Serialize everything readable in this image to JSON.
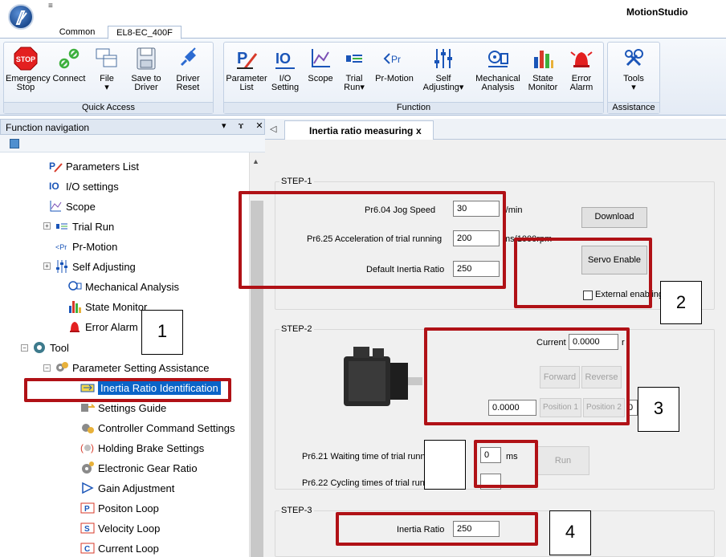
{
  "app": {
    "title": "MotionStudio",
    "qa_arrow": "≡"
  },
  "ribbon_tabs": [
    "Common",
    "EL8-EC_400F"
  ],
  "ribbon": {
    "quick_access": {
      "label": "Quick Access",
      "buttons": [
        {
          "label1": "Emergency",
          "label2": "Stop"
        },
        {
          "label1": "Connect",
          "label2": ""
        },
        {
          "label1": "File",
          "label2": "▾"
        },
        {
          "label1": "Save to",
          "label2": "Driver"
        },
        {
          "label1": "Driver",
          "label2": "Reset"
        }
      ]
    },
    "function": {
      "label": "Function",
      "buttons": [
        {
          "label1": "Parameter",
          "label2": "List"
        },
        {
          "label1": "I/O",
          "label2": "Setting"
        },
        {
          "label1": "Scope",
          "label2": ""
        },
        {
          "label1": "Trial",
          "label2": "Run▾"
        },
        {
          "label1": "Pr-Motion",
          "label2": ""
        },
        {
          "label1": "Self",
          "label2": "Adjusting▾"
        },
        {
          "label1": "Mechanical",
          "label2": "Analysis"
        },
        {
          "label1": "State",
          "label2": "Monitor"
        },
        {
          "label1": "Error",
          "label2": "Alarm"
        }
      ]
    },
    "assistance": {
      "label": "Assistance",
      "buttons": [
        {
          "label1": "Tools",
          "label2": "▾"
        }
      ]
    }
  },
  "nav": {
    "title": "Function navigation",
    "controls": "▾ ɤ ✕",
    "items": [
      {
        "label": "Parameters List"
      },
      {
        "label": "I/O settings"
      },
      {
        "label": "Scope"
      },
      {
        "label": "Trial Run"
      },
      {
        "label": "Pr-Motion"
      },
      {
        "label": "Self Adjusting"
      },
      {
        "label": "Mechanical Analysis"
      },
      {
        "label": "State Monitor"
      },
      {
        "label": "Error Alarm"
      },
      {
        "label": "Tool"
      },
      {
        "label": "Parameter Setting Assistance"
      },
      {
        "label": "Inertia Ratio Identification"
      },
      {
        "label": "Settings Guide"
      },
      {
        "label": "Controller Command Settings"
      },
      {
        "label": "Holding Brake Settings"
      },
      {
        "label": "Electronic Gear Ratio"
      },
      {
        "label": "Gain Adjustment"
      },
      {
        "label": "Positon Loop"
      },
      {
        "label": "Velocity Loop"
      },
      {
        "label": "Current Loop"
      }
    ]
  },
  "doc_tab": {
    "label": "Inertia ratio measuring",
    "close": "x",
    "left_arrow": "◁"
  },
  "step1": {
    "title": "STEP-1",
    "jog_speed_label": "Pr6.04 Jog Speed",
    "jog_speed_value": "30",
    "jog_speed_unit": "r/min",
    "accel_label": "Pr6.25 Acceleration of trial running",
    "accel_value": "200",
    "accel_unit": "ms/1000rpm",
    "inertia_label": "Default Inertia Ratio",
    "inertia_value": "250",
    "download": "Download",
    "servo_enable": "Servo Enable",
    "external_enabling": "External enabling"
  },
  "step2": {
    "title": "STEP-2",
    "current_label": "Current",
    "current_value": "0.0000",
    "current_unit": "r",
    "forward": "Forward",
    "reverse": "Reverse",
    "pos_value": "0.0000",
    "position1": "Position 1",
    "position2": "Position 2",
    "pos2_value": "0",
    "waiting_label": "Pr6.21 Waiting time of trial running",
    "waiting_value": "0",
    "waiting_unit": "ms",
    "cycling_label": "Pr6.22 Cycling times of trial running",
    "run": "Run"
  },
  "step3": {
    "title": "STEP-3",
    "inertia_label": "Inertia Ratio",
    "inertia_value": "250"
  },
  "callouts": [
    "1",
    "2",
    "3",
    "4"
  ],
  "colors": {
    "highlight": "#b01116",
    "selection": "#0a64c8"
  }
}
